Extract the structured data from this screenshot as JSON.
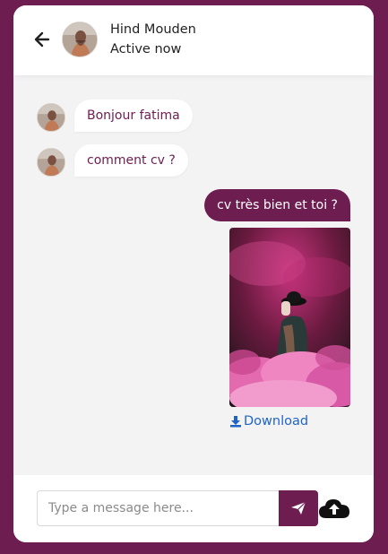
{
  "header": {
    "name": "Hind Mouden",
    "status": "Active now"
  },
  "messages": [
    {
      "direction": "incoming",
      "text": "Bonjour fatima"
    },
    {
      "direction": "incoming",
      "text": "comment cv ?"
    },
    {
      "direction": "outgoing",
      "text": "cv très bien et toi ?"
    }
  ],
  "attachment": {
    "download_label": "Download"
  },
  "composer": {
    "placeholder": "Type a message here..."
  },
  "colors": {
    "brand": "#6d1d50",
    "chat_background": "#f4f3f4",
    "link": "#1f63c6"
  },
  "icons": {
    "back": "arrow-left-icon",
    "send": "paper-plane-icon",
    "upload": "cloud-upload-icon",
    "download": "download-icon"
  }
}
